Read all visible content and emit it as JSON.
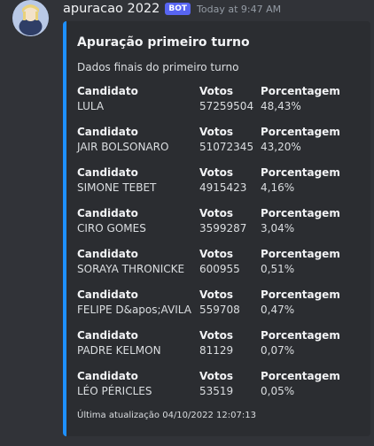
{
  "message": {
    "username": "apuracao 2022",
    "bot_tag": "BOT",
    "timestamp": "Today at 9:47 AM"
  },
  "embed": {
    "accent_color": "#1e90ff",
    "title": "Apuração primeiro turno",
    "description": "Dados finais do primeiro turno",
    "field_labels": {
      "candidate": "Candidato",
      "votes": "Votos",
      "percent": "Porcentagem"
    },
    "rows": [
      {
        "candidate": "LULA",
        "votes": "57259504",
        "percent": "48,43%"
      },
      {
        "candidate": "JAIR BOLSONARO",
        "votes": "51072345",
        "percent": "43,20%"
      },
      {
        "candidate": "SIMONE TEBET",
        "votes": "4915423",
        "percent": "4,16%"
      },
      {
        "candidate": "CIRO GOMES",
        "votes": "3599287",
        "percent": "3,04%"
      },
      {
        "candidate": "SORAYA THRONICKE",
        "votes": "600955",
        "percent": "0,51%"
      },
      {
        "candidate": "FELIPE D&apos;AVILA",
        "votes": "559708",
        "percent": "0,47%"
      },
      {
        "candidate": "PADRE KELMON",
        "votes": "81129",
        "percent": "0,07%"
      },
      {
        "candidate": "LÉO PÉRICLES",
        "votes": "53519",
        "percent": "0,05%"
      }
    ],
    "footer": "Última atualização 04/10/2022 12:07:13"
  }
}
